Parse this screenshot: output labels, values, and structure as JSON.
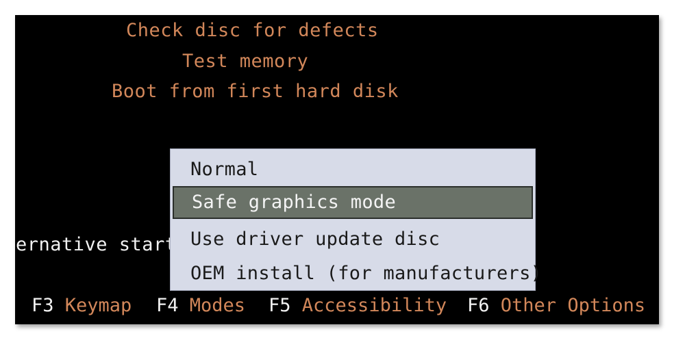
{
  "boot_menu": {
    "items": [
      {
        "label": "Check disc for defects"
      },
      {
        "label": "Test memory"
      },
      {
        "label": "Boot from first hard disk"
      }
    ],
    "partial_text": "ernative start"
  },
  "modes_popup": {
    "items": [
      {
        "label": "Normal",
        "selected": false
      },
      {
        "label": "Safe graphics mode",
        "selected": true
      },
      {
        "label": "Use driver update disc",
        "selected": false
      },
      {
        "label": "OEM install (for manufacturers)",
        "selected": false
      }
    ]
  },
  "function_keys": [
    {
      "key": "F3",
      "label": "Keymap"
    },
    {
      "key": "F4",
      "label": "Modes"
    },
    {
      "key": "F5",
      "label": "Accessibility"
    },
    {
      "key": "F6",
      "label": "Other Options"
    }
  ],
  "colors": {
    "background": "#000000",
    "menu_text": "#d2875a",
    "popup_bg": "#d7dbe8",
    "popup_selected_bg": "#6a7268"
  }
}
